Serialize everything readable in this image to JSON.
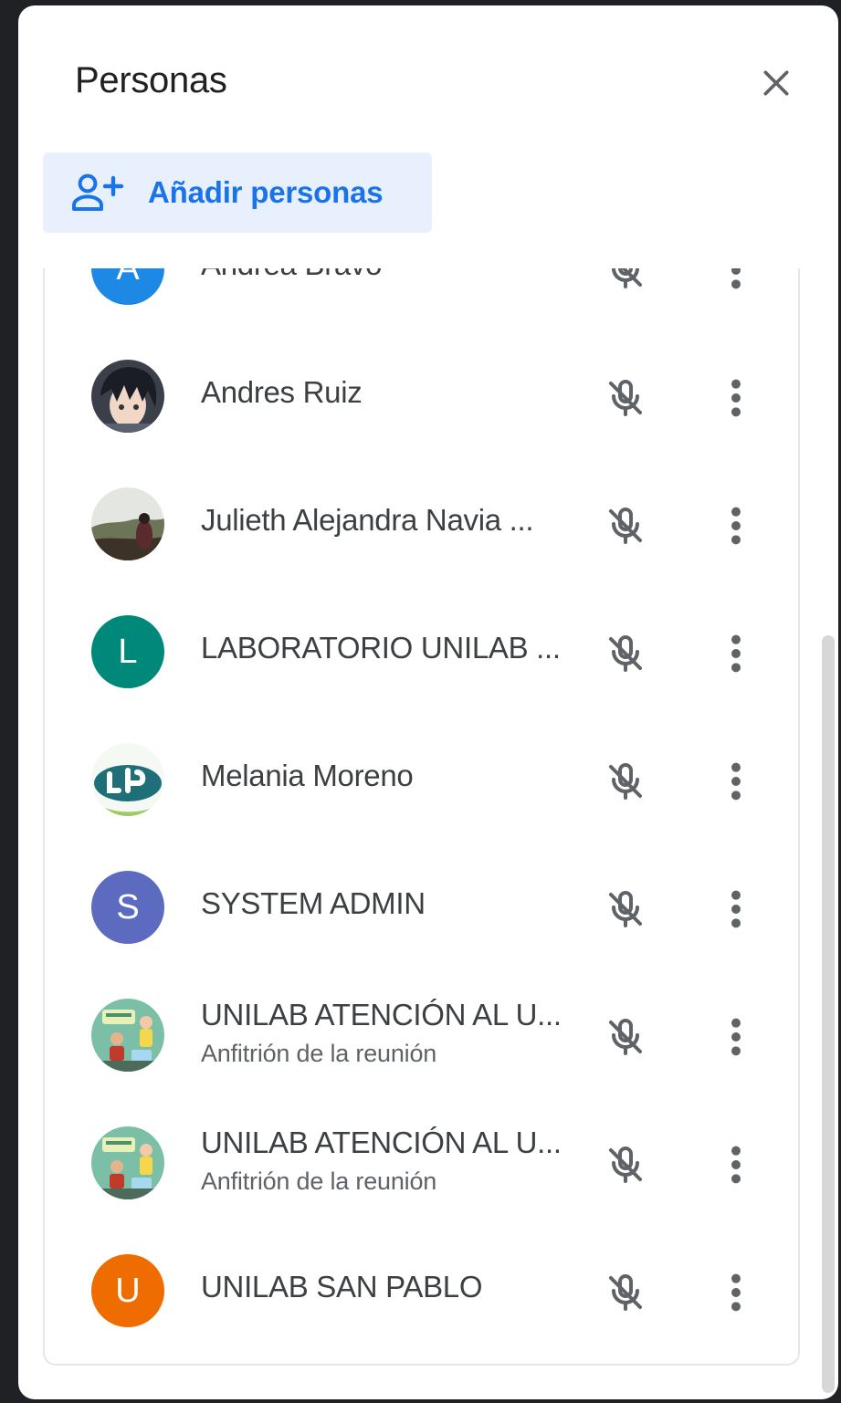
{
  "panel": {
    "title": "Personas",
    "add_people_label": "Añadir personas"
  },
  "participants": [
    {
      "name": "Andrea Bravo",
      "subtitle": "",
      "avatar": {
        "kind": "initial",
        "letter": "A",
        "color": "#1e88e5"
      }
    },
    {
      "name": "Andres Ruiz",
      "subtitle": "",
      "avatar": {
        "kind": "photo",
        "icon": "anime-portrait"
      }
    },
    {
      "name": "Julieth Alejandra Navia ...",
      "subtitle": "",
      "avatar": {
        "kind": "photo",
        "icon": "landscape-person"
      }
    },
    {
      "name": "LABORATORIO UNILAB ...",
      "subtitle": "",
      "avatar": {
        "kind": "initial",
        "letter": "L",
        "color": "#00897b"
      }
    },
    {
      "name": "Melania Moreno",
      "subtitle": "",
      "avatar": {
        "kind": "photo",
        "icon": "ule-logo"
      }
    },
    {
      "name": "SYSTEM ADMIN",
      "subtitle": "",
      "avatar": {
        "kind": "initial",
        "letter": "S",
        "color": "#5c6bc0"
      }
    },
    {
      "name": "UNILAB ATENCIÓN AL U...",
      "subtitle": "Anfitrión de la reunión",
      "avatar": {
        "kind": "photo",
        "icon": "unilab-illustration"
      }
    },
    {
      "name": "UNILAB ATENCIÓN AL U...",
      "subtitle": "Anfitrión de la reunión",
      "avatar": {
        "kind": "photo",
        "icon": "unilab-illustration"
      }
    },
    {
      "name": "UNILAB SAN PABLO",
      "subtitle": "",
      "avatar": {
        "kind": "initial",
        "letter": "U",
        "color": "#ef6c00"
      }
    }
  ],
  "icons": {
    "close": "close-icon",
    "add_person": "person-add-icon",
    "mic_off": "mic-off-icon",
    "more": "more-vert-icon"
  },
  "colors": {
    "accent": "#1a73e8",
    "add_button_bg": "#e8f0fe",
    "icon_gray": "#5f6368"
  }
}
